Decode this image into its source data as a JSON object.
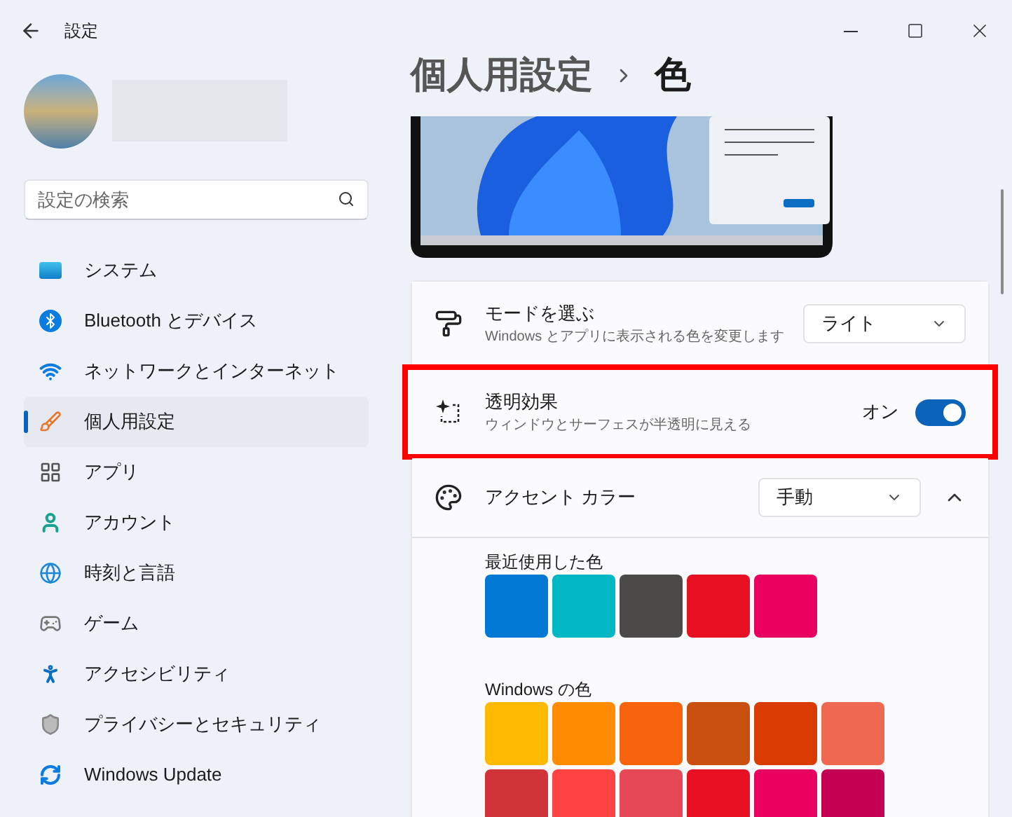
{
  "window": {
    "title": "設定"
  },
  "search": {
    "placeholder": "設定の検索"
  },
  "nav": [
    {
      "label": "システム",
      "selected": false
    },
    {
      "label": "Bluetooth とデバイス",
      "selected": false
    },
    {
      "label": "ネットワークとインターネット",
      "selected": false
    },
    {
      "label": "個人用設定",
      "selected": true
    },
    {
      "label": "アプリ",
      "selected": false
    },
    {
      "label": "アカウント",
      "selected": false
    },
    {
      "label": "時刻と言語",
      "selected": false
    },
    {
      "label": "ゲーム",
      "selected": false
    },
    {
      "label": "アクセシビリティ",
      "selected": false
    },
    {
      "label": "プライバシーとセキュリティ",
      "selected": false
    },
    {
      "label": "Windows Update",
      "selected": false
    }
  ],
  "breadcrumb": {
    "parent": "個人用設定",
    "current": "色"
  },
  "settings": [
    {
      "kind": "dropdown",
      "title": "モードを選ぶ",
      "description": "Windows とアプリに表示される色を変更します",
      "value": "ライト",
      "highlighted": false
    },
    {
      "kind": "toggle",
      "title": "透明効果",
      "description": "ウィンドウとサーフェスが半透明に見える",
      "state_label": "オン",
      "on": true,
      "highlighted": true
    },
    {
      "kind": "expander",
      "title": "アクセント カラー",
      "value": "手動",
      "expanded": true,
      "highlighted": false
    }
  ],
  "recent_colors": {
    "label": "最近使用した色",
    "swatches": [
      {
        "color": "#0078d4"
      },
      {
        "color": "#00b7c3"
      },
      {
        "color": "#4c4a48"
      },
      {
        "color": "#e81123"
      },
      {
        "color": "#ea005e"
      }
    ]
  },
  "windows_colors": {
    "label": "Windows の色",
    "swatches": [
      {
        "color": "#ffb900"
      },
      {
        "color": "#ff8c00"
      },
      {
        "color": "#f7630c"
      },
      {
        "color": "#ca5010"
      },
      {
        "color": "#da3b01"
      },
      {
        "color": "#ef6950"
      },
      {
        "color": "#d13438"
      },
      {
        "color": "#ff4343"
      },
      {
        "color": "#e74856"
      },
      {
        "color": "#e81123"
      },
      {
        "color": "#ea005e"
      },
      {
        "color": "#c30052"
      }
    ]
  }
}
